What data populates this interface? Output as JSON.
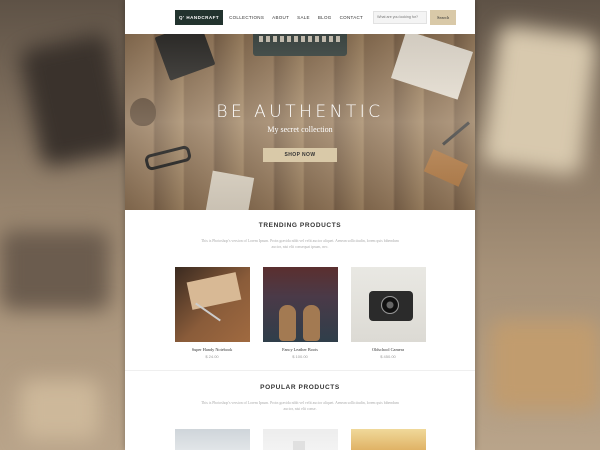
{
  "header": {
    "logo": "Q' HANDCRAFT",
    "nav": [
      "COLLECTIONS",
      "ABOUT",
      "SALE",
      "BLOG",
      "CONTACT"
    ],
    "search_placeholder": "What are you looking for?",
    "search_button": "Search"
  },
  "hero": {
    "title": "BE AUTHENTIC",
    "subtitle": "My secret collection",
    "cta": "SHOP NOW"
  },
  "trending": {
    "title": "TRENDING PRODUCTS",
    "description": "This is Photoshop's version of Lorem Ipsum. Proin gravida nibh vel velit auctor aliquet. Aenean sollicitudin, lorem quis bibendum auctor, nisi elit consequat ipsum, nec.",
    "products": [
      {
        "name": "Super Handy Notebook",
        "price": "$ 24.00"
      },
      {
        "name": "Fancy Leather Boots",
        "price": "$ 100.00"
      },
      {
        "name": "Oldschool Camera",
        "price": "$ 450.00"
      }
    ]
  },
  "popular": {
    "title": "POPULAR PRODUCTS",
    "description": "This is Photoshop's version of Lorem Ipsum. Proin gravida nibh vel velit auctor aliquet. Aenean sollicitudin, lorem quis bibendum auctor, nisi elit conse."
  },
  "colors": {
    "logo_bg": "#22332e",
    "accent": "#d9c9a8"
  }
}
